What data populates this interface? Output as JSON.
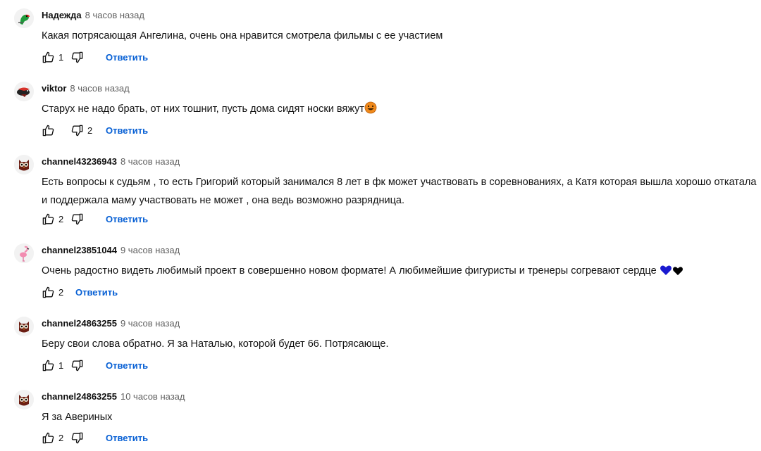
{
  "comments": [
    {
      "author": "Надежда",
      "time": "8 часов назад",
      "text": "Какая потрясающая Ангелина, очень она нравится смотрела фильмы с ее участием",
      "likes": "1",
      "dislikes": "",
      "reply": "Ответить",
      "avatar": "parrot-avatar"
    },
    {
      "author": "viktor",
      "time": "8 часов назад",
      "text": "Старух не надо брать, от них тошнит, пусть дома сидят носки вяжут",
      "likes": "",
      "dislikes": "2",
      "reply": "Ответить",
      "avatar": "bird-avatar"
    },
    {
      "author": "channel43236943",
      "time": "8 часов назад",
      "text": "Есть вопросы к судьям , то есть Григорий который занимался 8 лет в фк может участвовать в соревнованиях, а Катя которая вышла хорошо откатала и поддержала маму участвовать не может , она ведь возможно разрядница.",
      "likes": "2",
      "dislikes": "",
      "reply": "Ответить",
      "avatar": "owl-avatar"
    },
    {
      "author": "channel23851044",
      "time": "9 часов назад",
      "text": "Очень радостно видеть любимый проект в совершенно новом формате! А любимейшие фигуристы и тренеры согревают сердце",
      "likes": "2",
      "dislikes": "",
      "reply": "Ответить",
      "avatar": "flamingo-avatar"
    },
    {
      "author": "channel24863255",
      "time": "9 часов назад",
      "text": "Беру свои слова обратно. Я за Наталью, которой будет 66. Потрясающе.",
      "likes": "1",
      "dislikes": "",
      "reply": "Ответить",
      "avatar": "owl-avatar"
    },
    {
      "author": "channel24863255",
      "time": "10 часов назад",
      "text": "Я за Авериных",
      "likes": "2",
      "dislikes": "",
      "reply": "Ответить",
      "avatar": "owl-avatar"
    }
  ],
  "colors": {
    "link": "#065fd4",
    "meta": "#606060",
    "text": "#111111"
  }
}
